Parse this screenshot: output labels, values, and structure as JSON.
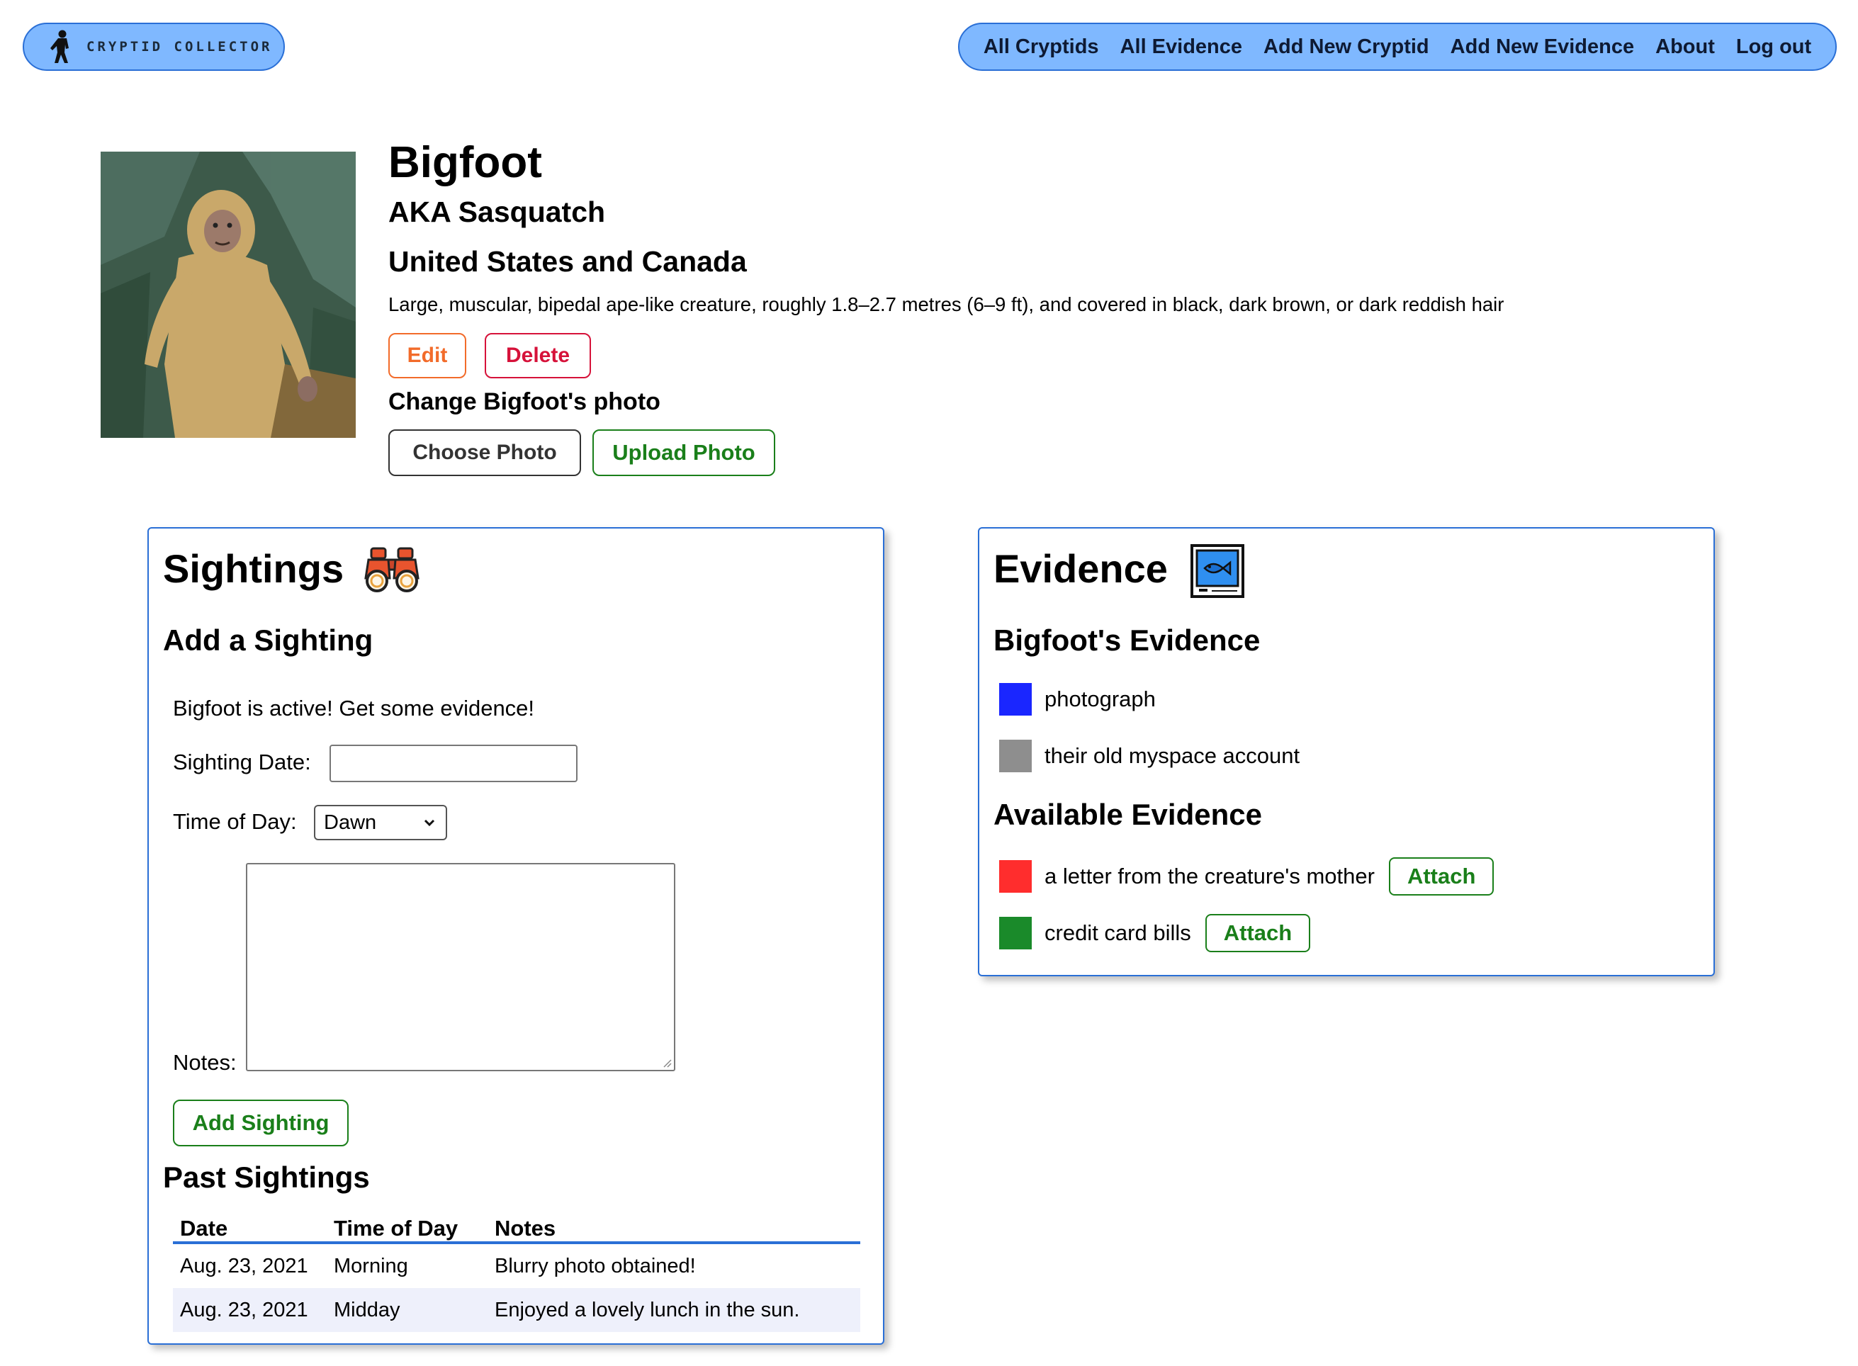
{
  "header": {
    "logo_text": "CRYPTID COLLECTOR",
    "nav": [
      "All Cryptids",
      "All Evidence",
      "Add New Cryptid",
      "Add New Evidence",
      "About",
      "Log out"
    ]
  },
  "cryptid": {
    "name": "Bigfoot",
    "aka": "AKA Sasquatch",
    "region": "United States and Canada",
    "description": "Large, muscular, bipedal ape-like creature, roughly 1.8–2.7 metres (6–9 ft), and covered in black, dark brown, or dark reddish hair",
    "edit_label": "Edit",
    "delete_label": "Delete",
    "change_photo_label": "Change Bigfoot's photo",
    "choose_photo_label": "Choose Photo",
    "upload_photo_label": "Upload Photo"
  },
  "sightings": {
    "title": "Sightings",
    "add_title": "Add a Sighting",
    "active_message": "Bigfoot is active! Get some evidence!",
    "date_label": "Sighting Date:",
    "date_value": "",
    "time_label": "Time of Day:",
    "time_selected": "Dawn",
    "notes_label": "Notes:",
    "notes_value": "",
    "add_button": "Add Sighting",
    "past_title": "Past Sightings",
    "columns": [
      "Date",
      "Time of Day",
      "Notes"
    ],
    "rows": [
      {
        "date": "Aug. 23, 2021",
        "time": "Morning",
        "notes": "Blurry photo obtained!"
      },
      {
        "date": "Aug. 23, 2021",
        "time": "Midday",
        "notes": "Enjoyed a lovely lunch in the sun."
      }
    ]
  },
  "evidence": {
    "title": "Evidence",
    "icon": "fish-tv-icon",
    "bigfoot_title": "Bigfoot's Evidence",
    "bigfoot_items": [
      {
        "label": "photograph",
        "color": "#1a26ff"
      },
      {
        "label": "their old myspace account",
        "color": "#8e8e8e"
      }
    ],
    "available_title": "Available Evidence",
    "available_items": [
      {
        "label": "a letter from the creature's mother",
        "color": "#ff2d2d",
        "button": "Attach"
      },
      {
        "label": "credit card bills",
        "color": "#1a8a2a",
        "button": "Attach"
      }
    ]
  },
  "colors": {
    "nav_bg": "#7fb8ff",
    "card_border": "#2a6fd6",
    "edit": "#f26b2a",
    "delete": "#d6123a",
    "success": "#1a7f1a"
  }
}
